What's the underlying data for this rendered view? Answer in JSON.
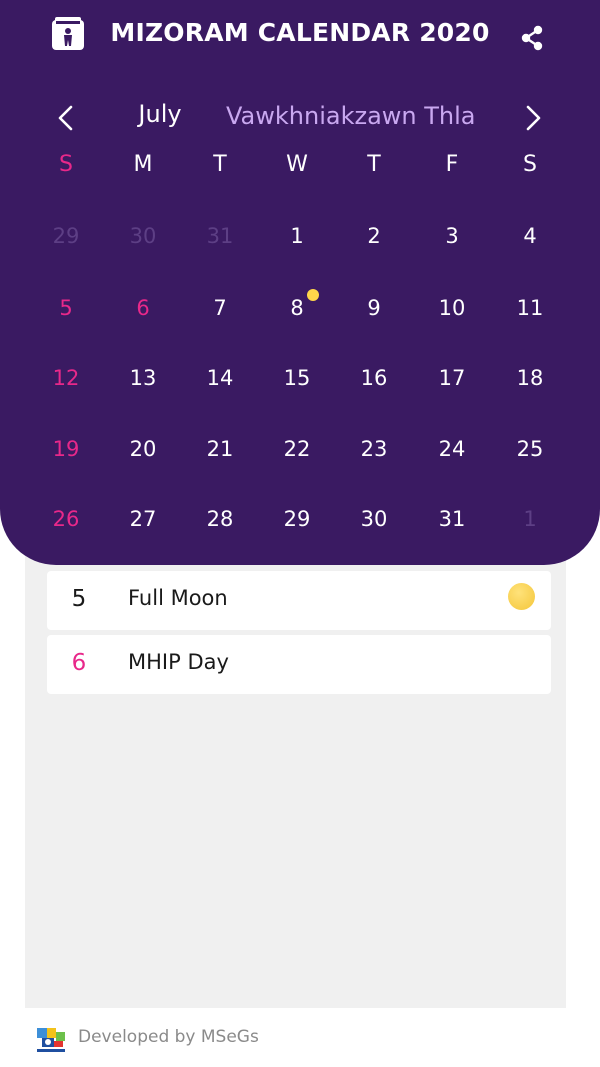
{
  "app": {
    "title": "MIZORAM CALENDAR 2020"
  },
  "month": {
    "english": "July",
    "mizo": "Vawkhniakzawn  Thla"
  },
  "weekdays": [
    "S",
    "M",
    "T",
    "W",
    "T",
    "F",
    "S"
  ],
  "weeks": [
    [
      "29",
      "30",
      "31",
      "1",
      "2",
      "3",
      "4"
    ],
    [
      "5",
      "6",
      "7",
      "8",
      "9",
      "10",
      "11"
    ],
    [
      "12",
      "13",
      "14",
      "15",
      "16",
      "17",
      "18"
    ],
    [
      "19",
      "20",
      "21",
      "22",
      "23",
      "24",
      "25"
    ],
    [
      "26",
      "27",
      "28",
      "29",
      "30",
      "31",
      "1"
    ]
  ],
  "events": [
    {
      "day": "5",
      "name": "Full Moon"
    },
    {
      "day": "6",
      "name": "MHIP Day"
    }
  ],
  "footer": {
    "text": "Developed by MSeGs",
    "logo_caption": "MSeGS"
  },
  "colors": {
    "header_bg": "#3a1a62",
    "holiday": "#e8288a",
    "mizo_month": "#c9a8f0",
    "muted_day": "#5d3f85",
    "moon": "#ffd64a"
  },
  "icons": {
    "app": "calendar-person-icon",
    "share": "share-icon",
    "prev": "chevron-left-icon",
    "next": "chevron-right-icon",
    "moon": "full-moon-icon"
  }
}
